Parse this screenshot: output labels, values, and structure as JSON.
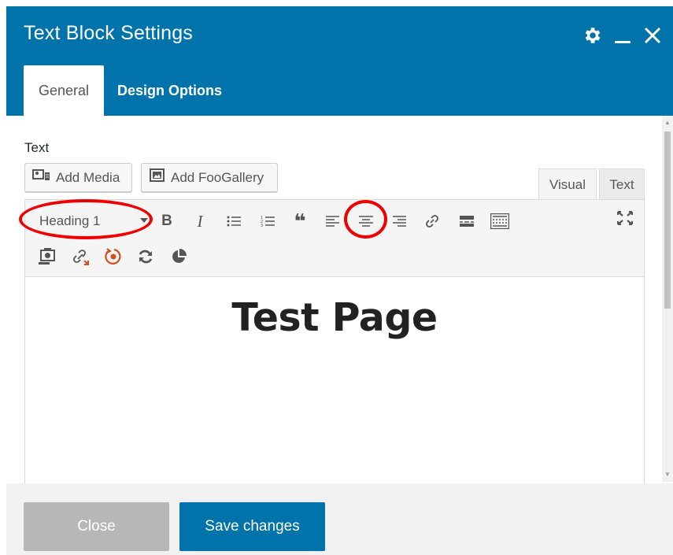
{
  "dialog": {
    "title": "Text Block Settings",
    "header_icons": [
      "gear-icon",
      "minimize-icon",
      "close-icon"
    ],
    "accent_color": "#0073aa"
  },
  "tabs": [
    {
      "label": "General",
      "active": true
    },
    {
      "label": "Design Options",
      "active": false
    }
  ],
  "field": {
    "label": "Text"
  },
  "media_buttons": {
    "add_media": "Add Media",
    "add_foogallery": "Add FooGallery"
  },
  "editor_tabs": {
    "visual": "Visual",
    "text": "Text"
  },
  "toolbar": {
    "format_value": "Heading 1",
    "row1_icons": [
      "bold-icon",
      "italic-icon",
      "bulleted-list-icon",
      "numbered-list-icon",
      "blockquote-icon",
      "align-left-icon",
      "align-center-icon",
      "align-right-icon",
      "link-icon",
      "read-more-icon",
      "toolbar-toggle-icon",
      "fullscreen-icon"
    ],
    "row2_icons": [
      "screenshot-icon",
      "unlink-icon",
      "target-icon",
      "refresh-icon",
      "pie-chart-icon"
    ],
    "bold_glyph": "B",
    "italic_glyph": "I",
    "quote_glyph": "❝"
  },
  "content": {
    "heading": "Test Page"
  },
  "annotations": {
    "highlight_color": "#e00000",
    "highlighted": [
      "format-select",
      "align-center-button"
    ]
  },
  "footer": {
    "close_label": "Close",
    "save_label": "Save changes"
  }
}
